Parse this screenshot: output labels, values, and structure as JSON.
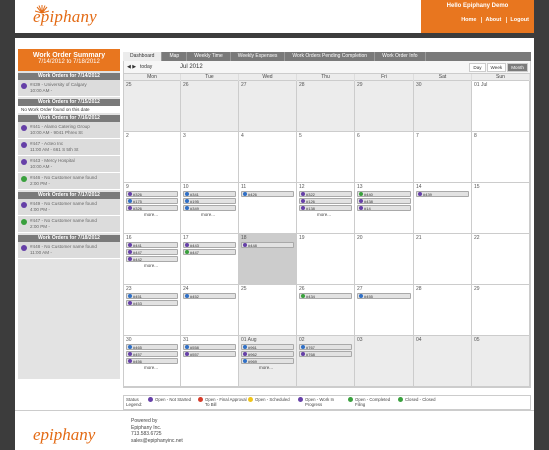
{
  "header": {
    "logo": "epiphany",
    "greeting": "Hello Epiphany Demo",
    "nav": [
      "Home",
      "About",
      "Logout"
    ]
  },
  "sidebar": {
    "title": "Work Order Summary",
    "range": "7/14/2012 to 7/18/2012",
    "groups": [
      {
        "date": "Work Orders for 7/14/2012",
        "items": [
          {
            "icon": "purple",
            "line1": "#439 - University of Calgary",
            "line2": "10:00 AM -"
          }
        ]
      },
      {
        "date": "Work Orders for 7/15/2012",
        "none": "No Work Order found on this date",
        "items": []
      },
      {
        "date": "Work Orders for 7/16/2012",
        "items": [
          {
            "icon": "purple",
            "line1": "#441 - Alamo Catering Group",
            "line2": "10:00 AM - 9041 Phrex St"
          },
          {
            "icon": "purple",
            "line1": "#447 - Acteo Inc",
            "line2": "11:00 AM - 661 S 5th St"
          },
          {
            "icon": "purple",
            "line1": "#443 - Mercy Hospital",
            "line2": "10:00 AM -"
          },
          {
            "icon": "green",
            "line1": "#446 - No Customer name found",
            "line2": "2:00 PM -"
          }
        ]
      },
      {
        "date": "Work Orders for 7/17/2012",
        "items": [
          {
            "icon": "purple",
            "line1": "#449 - No Customer name found",
            "line2": "4:00 PM -"
          },
          {
            "icon": "green",
            "line1": "#447 - No Customer name found",
            "line2": "2:00 PM -"
          }
        ]
      },
      {
        "date": "Work Orders for 7/18/2012",
        "items": [
          {
            "icon": "purple",
            "line1": "#448 - No Customer name found",
            "line2": "11:00 AM -"
          }
        ]
      }
    ]
  },
  "tabs": [
    "Dashboard",
    "Map",
    "Weekly Time",
    "Weekly Expenses",
    "Work Orders Pending Completion",
    "Work Order Info"
  ],
  "active_tab": "Dashboard",
  "toolbar": {
    "prev": "◀",
    "next": "▶",
    "today": "today",
    "title": "Jul 2012",
    "views": [
      "Day",
      "Week",
      "Month"
    ],
    "active_view": "Month"
  },
  "calendar": {
    "dow": [
      "Mon",
      "Tue",
      "Wed",
      "Thu",
      "Fri",
      "Sat",
      "Sun"
    ],
    "weeks": [
      [
        {
          "n": "25",
          "s": true
        },
        {
          "n": "26",
          "s": true
        },
        {
          "n": "27",
          "s": true
        },
        {
          "n": "28",
          "s": true
        },
        {
          "n": "29",
          "s": true
        },
        {
          "n": "30",
          "s": true
        },
        {
          "n": "01 Jul"
        }
      ],
      [
        {
          "n": "2"
        },
        {
          "n": "3"
        },
        {
          "n": "4"
        },
        {
          "n": "5"
        },
        {
          "n": "6"
        },
        {
          "n": "7"
        },
        {
          "n": "8"
        }
      ],
      [
        {
          "n": "9",
          "ev": [
            [
              "purple",
              "#326"
            ],
            [
              "blue",
              "#175"
            ],
            [
              "purple",
              "#326"
            ]
          ],
          "more": "more..."
        },
        {
          "n": "10",
          "ev": [
            [
              "blue",
              "#341"
            ],
            [
              "blue",
              "#195"
            ],
            [
              "blue",
              "#349"
            ]
          ],
          "more": "more..."
        },
        {
          "n": "11",
          "ev": [
            [
              "blue",
              "#426"
            ]
          ]
        },
        {
          "n": "12",
          "ev": [
            [
              "purple",
              "#322"
            ],
            [
              "purple",
              "#126"
            ],
            [
              "purple",
              "#138"
            ]
          ],
          "more": "more..."
        },
        {
          "n": "13",
          "ev": [
            [
              "green",
              "#440"
            ],
            [
              "purple",
              "#438"
            ],
            [
              "purple",
              "#14"
            ]
          ]
        },
        {
          "n": "14",
          "ev": [
            [
              "purple",
              "#439"
            ]
          ]
        },
        {
          "n": "15"
        }
      ],
      [
        {
          "n": "16",
          "ev": [
            [
              "purple",
              "#441"
            ],
            [
              "purple",
              "#447"
            ],
            [
              "purple",
              "#442"
            ]
          ],
          "more": "more..."
        },
        {
          "n": "17",
          "ev": [
            [
              "purple",
              "#443"
            ],
            [
              "green",
              "#447"
            ]
          ]
        },
        {
          "n": "18",
          "sel": true,
          "ev": [
            [
              "purple",
              "#448"
            ]
          ]
        },
        {
          "n": "19"
        },
        {
          "n": "20"
        },
        {
          "n": "21"
        },
        {
          "n": "22"
        }
      ],
      [
        {
          "n": "23",
          "ev": [
            [
              "blue",
              "#451"
            ],
            [
              "purple",
              "#453"
            ]
          ]
        },
        {
          "n": "24",
          "ev": [
            [
              "blue",
              "#452"
            ]
          ]
        },
        {
          "n": "25"
        },
        {
          "n": "26",
          "ev": [
            [
              "green",
              "#434"
            ]
          ]
        },
        {
          "n": "27",
          "ev": [
            [
              "blue",
              "#455"
            ]
          ]
        },
        {
          "n": "28"
        },
        {
          "n": "29"
        }
      ],
      [
        {
          "n": "30",
          "ev": [
            [
              "blue",
              "#465"
            ],
            [
              "purple",
              "#457"
            ],
            [
              "purple",
              "#456"
            ]
          ],
          "more": "more..."
        },
        {
          "n": "31",
          "ev": [
            [
              "blue",
              "#558"
            ],
            [
              "purple",
              "#557"
            ]
          ]
        },
        {
          "n": "01 Aug",
          "s": true,
          "ev": [
            [
              "blue",
              "#961"
            ],
            [
              "purple",
              "#962"
            ],
            [
              "blue",
              "#969"
            ]
          ],
          "more": "more..."
        },
        {
          "n": "02",
          "s": true,
          "ev": [
            [
              "blue",
              "#767"
            ],
            [
              "purple",
              "#768"
            ]
          ]
        },
        {
          "n": "03",
          "s": true
        },
        {
          "n": "04",
          "s": true
        },
        {
          "n": "05",
          "s": true
        }
      ]
    ]
  },
  "legend": {
    "label": "Status Legend:",
    "items": [
      {
        "icon": "purple",
        "text": "Open - Not Started"
      },
      {
        "icon": "red",
        "text": "Open - Final Approval To Bill"
      },
      {
        "icon": "yellow",
        "text": "Open - Scheduled"
      },
      {
        "icon": "purple",
        "text": "Open - Work In Progress"
      },
      {
        "icon": "green",
        "text": "Open - Completed Filing"
      },
      {
        "icon": "green",
        "text": "Closed - Closed"
      }
    ]
  },
  "footer": {
    "logo": "epiphany",
    "lines": [
      "Powered by",
      "Epiphany Inc.",
      "713.583.6725",
      "sales@epiphanyinc.net"
    ]
  },
  "colors": {
    "accent": "#e8761f",
    "tab_bg": "#7a7a7a",
    "open_purple": "#6640a8",
    "closed_green": "#39a03d",
    "blue": "#2f6fc6"
  }
}
